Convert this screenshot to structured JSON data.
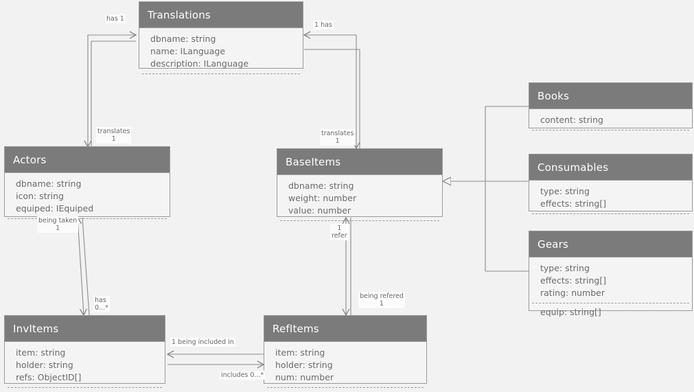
{
  "diagram": {
    "title": "UML class diagram",
    "background_color": "#f2f2f2",
    "header_color": "#7b7b7b",
    "body_color": "#f4f4f4",
    "border_color": "#9a9a9a",
    "text_color": "#6d6a66",
    "classes": [
      {
        "id": "translations",
        "name": "Translations",
        "attributes": [
          "dbname: string",
          "name: ILanguage",
          "description: ILanguage"
        ],
        "extra": []
      },
      {
        "id": "actors",
        "name": "Actors",
        "attributes": [
          "dbname: string",
          "icon: string",
          "equiped: IEquiped"
        ],
        "extra": []
      },
      {
        "id": "baseitems",
        "name": "BaseItems",
        "attributes": [
          "dbname: string",
          "weight: number",
          "value: number"
        ],
        "extra": []
      },
      {
        "id": "books",
        "name": "Books",
        "attributes": [
          "content: string"
        ],
        "extra": []
      },
      {
        "id": "consumables",
        "name": "Consumables",
        "attributes": [
          "type: string",
          "effects: string[]"
        ],
        "extra": []
      },
      {
        "id": "gears",
        "name": "Gears",
        "attributes": [
          "type: string",
          "effects: string[]",
          "rating: number"
        ],
        "extra": [
          "equip: string[]"
        ]
      },
      {
        "id": "invitems",
        "name": "InvItems",
        "attributes": [
          "item: string",
          "holder: string",
          "refs: ObjectID[]"
        ],
        "extra": []
      },
      {
        "id": "refitems",
        "name": "RefItems",
        "attributes": [
          "item: string",
          "holder: string",
          "num: number"
        ],
        "extra": []
      }
    ],
    "edge_labels": [
      {
        "id": "actors-has-translations",
        "line1": "has 1",
        "line2": ""
      },
      {
        "id": "baseitems-has-translations",
        "line1": "1 has",
        "line2": ""
      },
      {
        "id": "translations-translates-actors",
        "line1": "translates",
        "line2": "1"
      },
      {
        "id": "translations-translates-baseitems",
        "line1": "translates",
        "line2": "1"
      },
      {
        "id": "actors-being-taken",
        "line1": "being taken",
        "line2": "1"
      },
      {
        "id": "actors-has-invitems",
        "line1": "has",
        "line2": "0...*"
      },
      {
        "id": "baseitems-refer",
        "line1": "1",
        "line2": "refer"
      },
      {
        "id": "refitems-being-refered",
        "line1": "being refered",
        "line2": "1"
      },
      {
        "id": "invitems-being-included-in",
        "line1": "1 being included in",
        "line2": ""
      },
      {
        "id": "refitems-includes",
        "line1": "includes 0...*",
        "line2": ""
      }
    ],
    "relationships": [
      {
        "from": "books",
        "to": "baseitems",
        "type": "generalization"
      },
      {
        "from": "consumables",
        "to": "baseitems",
        "type": "generalization"
      },
      {
        "from": "gears",
        "to": "baseitems",
        "type": "generalization"
      },
      {
        "from": "actors",
        "to": "translations",
        "type": "association"
      },
      {
        "from": "baseitems",
        "to": "translations",
        "type": "association"
      },
      {
        "from": "actors",
        "to": "invitems",
        "type": "association"
      },
      {
        "from": "baseitems",
        "to": "refitems",
        "type": "association"
      },
      {
        "from": "invitems",
        "to": "refitems",
        "type": "association"
      }
    ]
  }
}
